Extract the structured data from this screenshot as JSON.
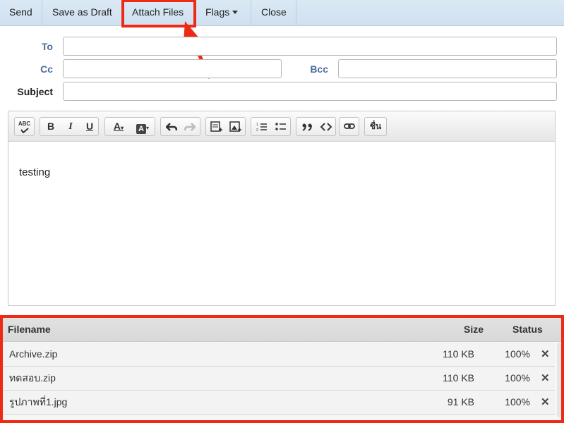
{
  "toolbar": {
    "send_label": "Send",
    "save_draft_label": "Save as Draft",
    "attach_label": "Attach Files",
    "flags_label": "Flags",
    "close_label": "Close"
  },
  "header": {
    "to_label": "To",
    "to_value": "",
    "cc_label": "Cc",
    "cc_value": "",
    "bcc_label": "Bcc",
    "bcc_value": "",
    "subject_label": "Subject",
    "subject_value": ""
  },
  "editor": {
    "toolbar_icons": [
      "spellcheck-icon",
      "bold-icon",
      "italic-icon",
      "underline-icon",
      "text-color-icon",
      "background-color-icon",
      "undo-icon",
      "redo-icon",
      "insert-block-icon",
      "insert-image-icon",
      "numbered-list-icon",
      "bullet-list-icon",
      "blockquote-icon",
      "code-icon",
      "link-icon",
      "thai-text-icon"
    ],
    "button_labels": {
      "spellcheck": "ABC",
      "bold": "B",
      "italic": "I",
      "underline": "U",
      "text_color": "A",
      "bg_color": "A",
      "thai": "ชื่น"
    },
    "body_text": "testing"
  },
  "attachments": {
    "headers": {
      "filename": "Filename",
      "size": "Size",
      "status": "Status"
    },
    "rows": [
      {
        "filename": "Archive.zip",
        "size": "110 KB",
        "status": "100%",
        "remove": "✕"
      },
      {
        "filename": "ทดสอบ.zip",
        "size": "110 KB",
        "status": "100%",
        "remove": "✕"
      },
      {
        "filename": "รูปภาพที่1.jpg",
        "size": "91 KB",
        "status": "100%",
        "remove": "✕"
      }
    ]
  },
  "colors": {
    "highlight": "#ee2a16",
    "toolbar_bg": "#d5e5f2",
    "label_blue": "#4b6d9b"
  }
}
